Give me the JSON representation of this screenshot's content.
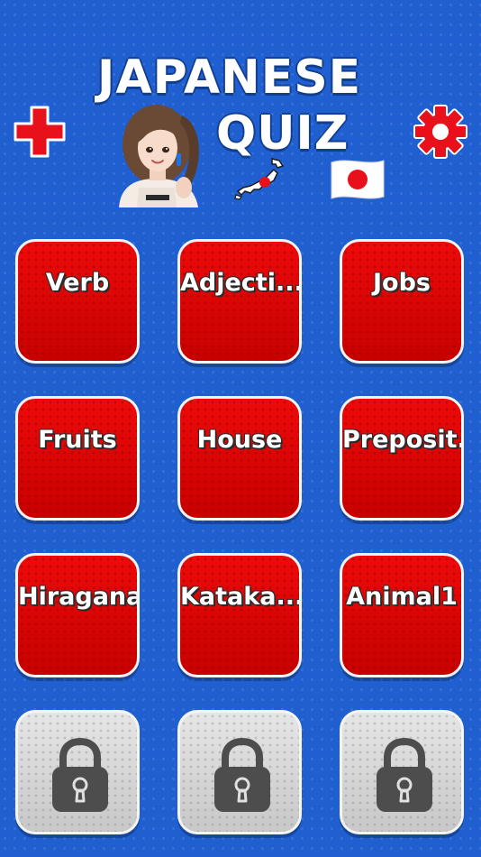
{
  "header": {
    "title_line_1": "JAPANESE",
    "title_line_2": "QUIZ",
    "left_button_icon": "plus-icon",
    "right_button_icon": "gear-icon"
  },
  "categories": [
    {
      "label": "Verb",
      "locked": false
    },
    {
      "label": "Adjecti...",
      "locked": false
    },
    {
      "label": "Jobs",
      "locked": false
    },
    {
      "label": "Fruits",
      "locked": false
    },
    {
      "label": "House",
      "locked": false
    },
    {
      "label": "Preposit...",
      "locked": false
    },
    {
      "label": "Hiragana",
      "locked": false
    },
    {
      "label": "Kataka...",
      "locked": false
    },
    {
      "label": "Animal1",
      "locked": false
    },
    {
      "label": "",
      "locked": true,
      "icon": "lock-icon"
    },
    {
      "label": "",
      "locked": true,
      "icon": "lock-icon"
    },
    {
      "label": "",
      "locked": true,
      "icon": "lock-icon"
    }
  ],
  "colors": {
    "background": "#1f5fd0",
    "tile_red": "#e00000",
    "tile_locked": "#d8d8d8",
    "accent_red": "#e8101a",
    "title_white": "#ffffff"
  }
}
